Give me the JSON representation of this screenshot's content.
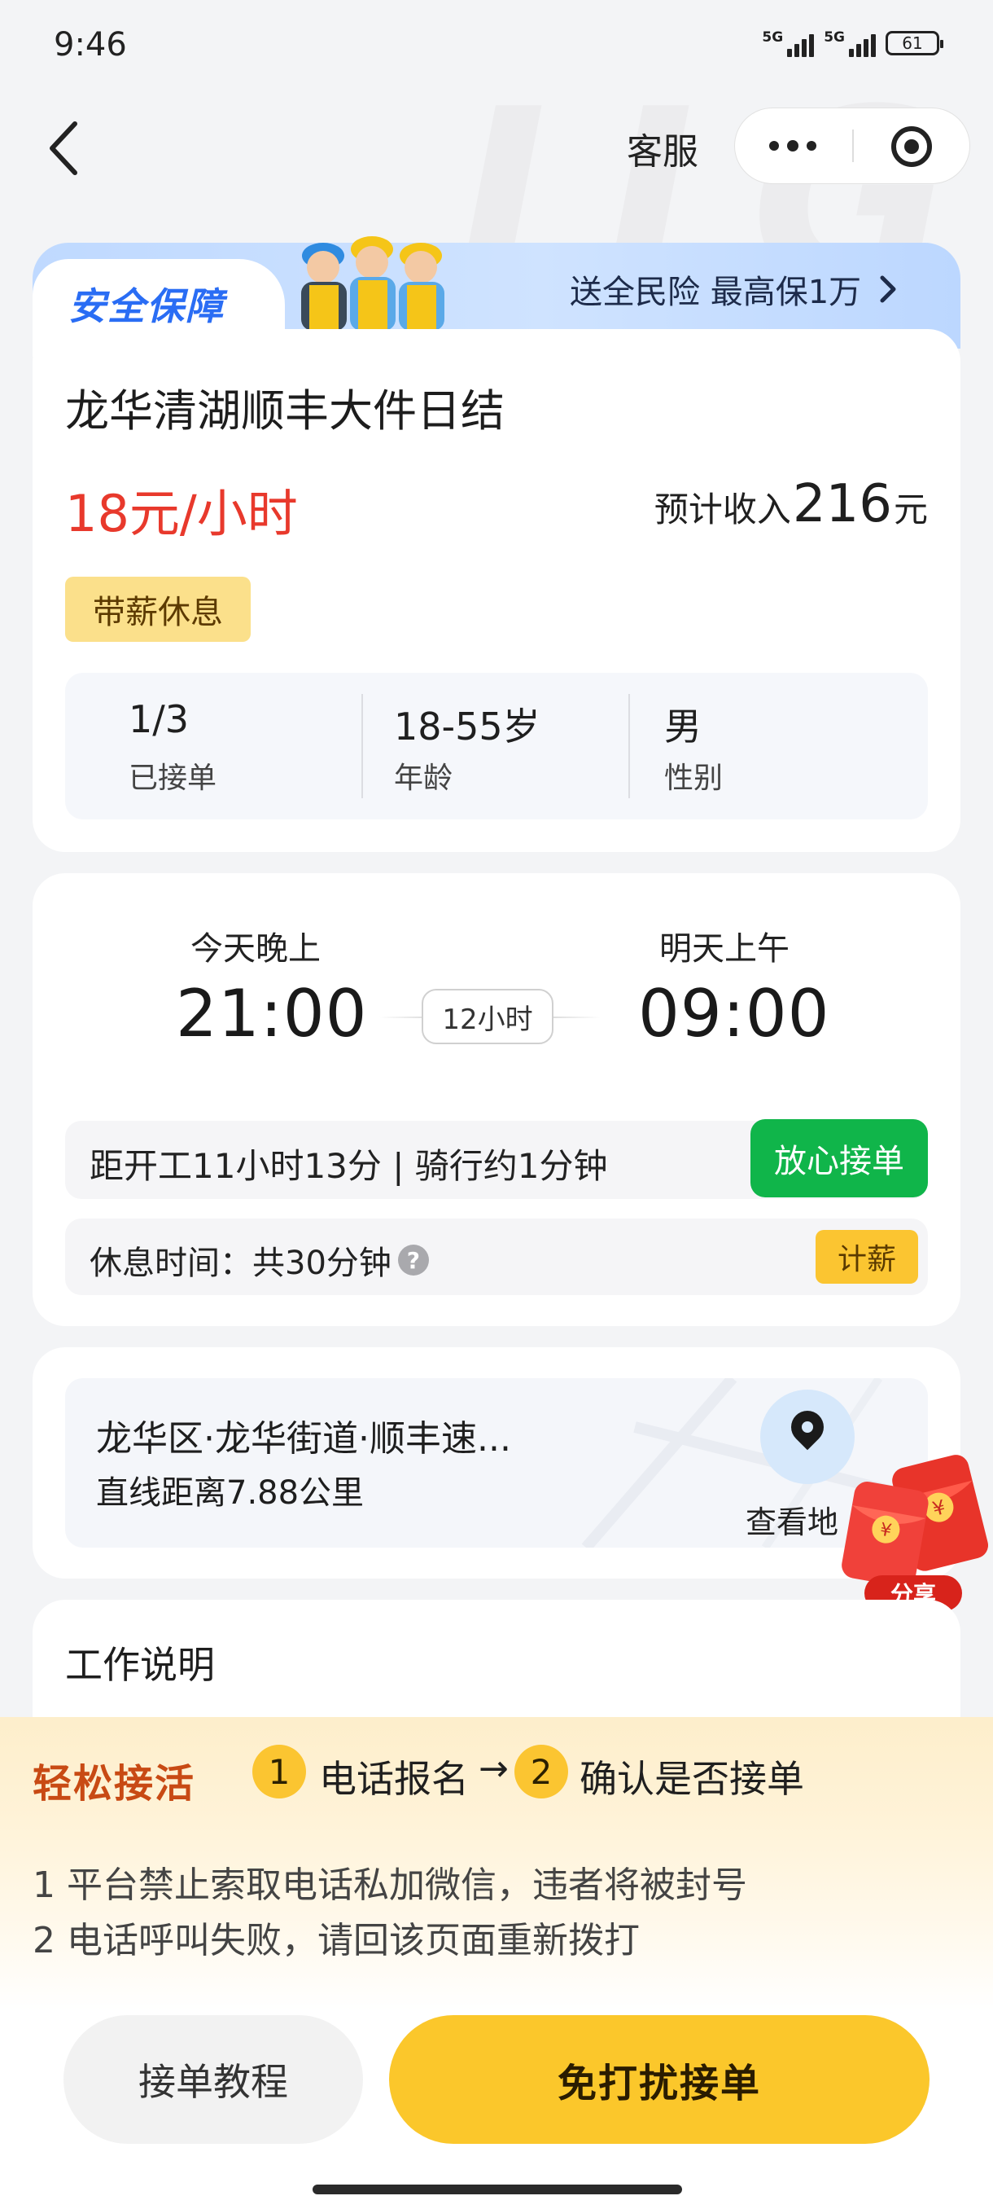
{
  "status_bar": {
    "time": "9:46",
    "signal1": "5G",
    "signal2": "5G",
    "battery": "61"
  },
  "nav": {
    "kefu": "客服"
  },
  "banner": {
    "title": "安全保障",
    "insurance": "送全民险 最高保1万",
    "chevron": "›"
  },
  "job": {
    "title": "龙华清湖顺丰大件日结",
    "wage": "18元/小时",
    "income_prefix": "预计收入",
    "income_value": "216",
    "income_suffix": "元",
    "tag": "带薪休息",
    "stats": [
      {
        "value": "1/3",
        "label": "已接单"
      },
      {
        "value": "18-55岁",
        "label": "年龄"
      },
      {
        "value": "男",
        "label": "性别"
      }
    ]
  },
  "schedule": {
    "start_label": "今天晚上",
    "start_time": "21:00",
    "duration": "12小时",
    "end_label": "明天上午",
    "end_time": "09:00",
    "commute": "距开工11小时13分 | 骑行约1分钟",
    "accept_button": "放心接单",
    "break": "休息时间：共30分钟",
    "break_help": "?",
    "pay_badge": "计薪"
  },
  "location": {
    "address": "龙华区·龙华街道·顺丰速...",
    "distance": "直线距离7.88公里",
    "view_map": "查看地",
    "pin_icon": "location-pin-icon"
  },
  "share": {
    "label": "分享",
    "icon": "red-packet-icon",
    "coin": "¥"
  },
  "work": {
    "title": "工作说明"
  },
  "bottom": {
    "easy_title": "轻松接活",
    "step1_num": "1",
    "step1_text": "电话报名",
    "arrow": "→",
    "step2_num": "2",
    "step2_text": "确认是否接单",
    "notice1": "1 平台禁止索取电话私加微信，违者将被封号",
    "notice2": "2 电话呼叫失败，请回该页面重新拨打",
    "tutorial_button": "接单教程",
    "primary_button": "免打扰接单"
  },
  "colors": {
    "wage_red": "#e8392c",
    "accept_green": "#10b54a",
    "primary_yellow": "#fbc72b",
    "brand_blue": "#2a6df4"
  }
}
